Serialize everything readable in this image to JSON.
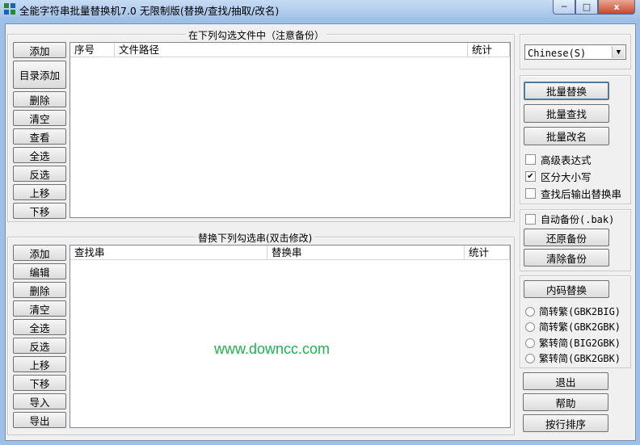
{
  "window": {
    "title": "全能字符串批量替换机7.0 无限制版(替换/查找/抽取/改名)",
    "controls": {
      "minimize": "─",
      "maximize": "□",
      "close": "x"
    }
  },
  "files_group": {
    "legend": "在下列勾选文件中（注意备份）",
    "buttons": [
      "添加",
      "目录添加",
      "删除",
      "清空",
      "查看",
      "全选",
      "反选",
      "上移",
      "下移"
    ],
    "columns": [
      "序号",
      "文件路径",
      "统计"
    ]
  },
  "replace_group": {
    "legend": "替换下列勾选串(双击修改)",
    "buttons": [
      "添加",
      "编辑",
      "删除",
      "清空",
      "全选",
      "反选",
      "上移",
      "下移",
      "导入",
      "导出"
    ],
    "columns": [
      "查找串",
      "替换串",
      "统计"
    ]
  },
  "language_select": {
    "value": "Chinese(S)"
  },
  "actions_group": {
    "buttons": [
      "批量替换",
      "批量查找",
      "批量改名"
    ],
    "options": [
      {
        "label": "高级表达式",
        "checked": false
      },
      {
        "label": "区分大小写",
        "checked": true
      },
      {
        "label": "查找后输出替换串",
        "checked": false
      }
    ]
  },
  "backup_group": {
    "auto_backup": {
      "label": "自动备份(.bak)",
      "checked": false
    },
    "buttons": [
      "还原备份",
      "清除备份"
    ]
  },
  "encoding_group": {
    "button": "内码替换",
    "radios": [
      "简转繁(GBK2BIG)",
      "简转繁(GBK2GBK)",
      "繁转简(BIG2GBK)",
      "繁转简(GBK2GBK)"
    ]
  },
  "bottom_buttons": [
    "退出",
    "帮助",
    "按行排序"
  ],
  "watermark": "www.downcc.com"
}
